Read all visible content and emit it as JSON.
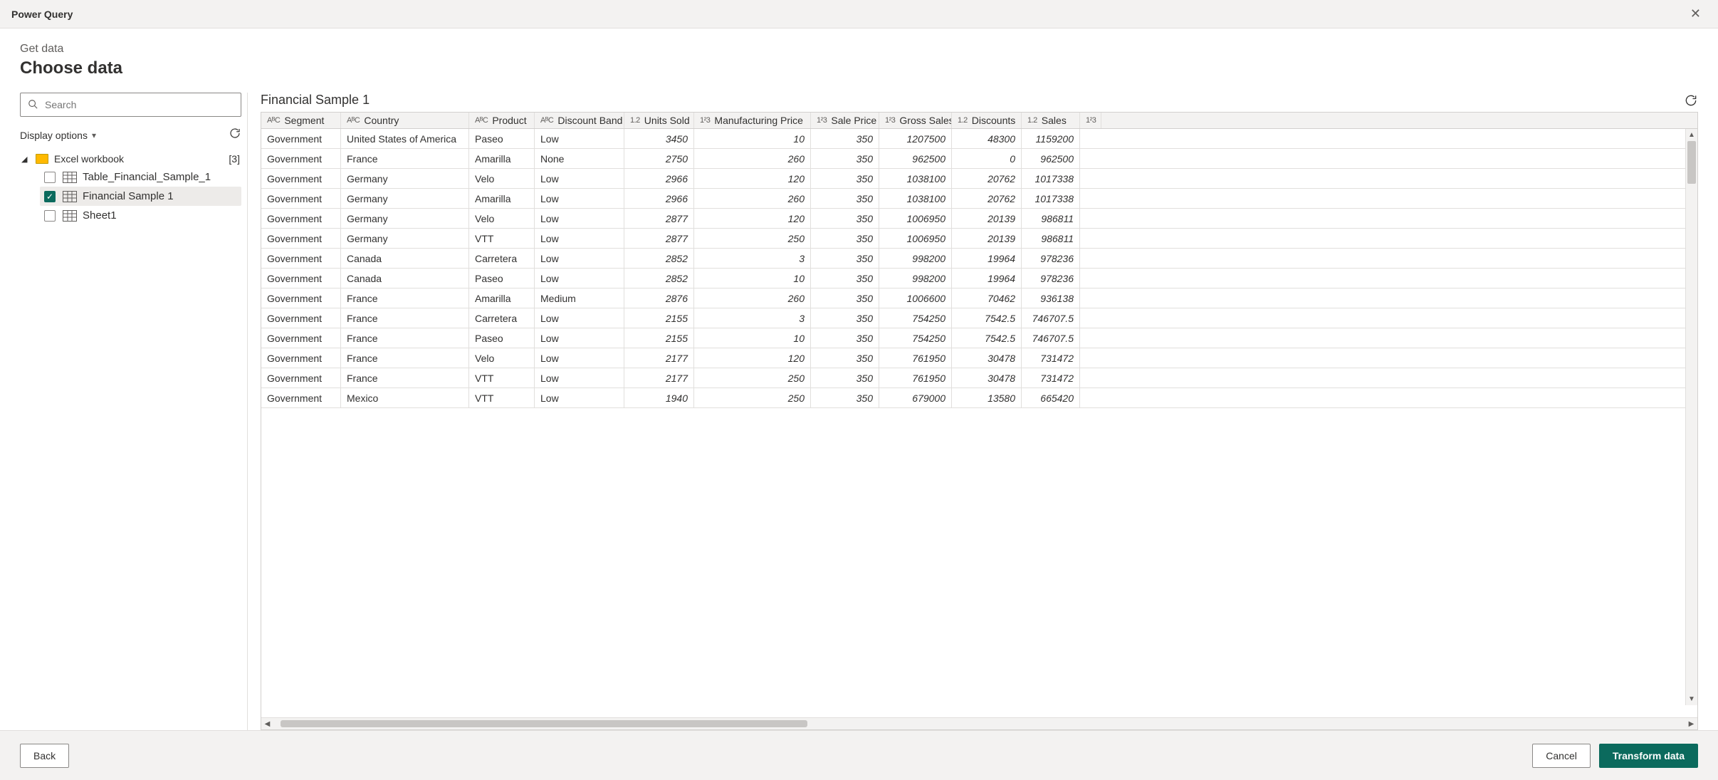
{
  "window": {
    "title": "Power Query"
  },
  "header": {
    "breadcrumb": "Get data",
    "title": "Choose data"
  },
  "left": {
    "search_placeholder": "Search",
    "display_options": "Display options",
    "root": {
      "label": "Excel workbook",
      "count": "[3]"
    },
    "items": [
      {
        "label": "Table_Financial_Sample_1",
        "checked": false,
        "selected": false
      },
      {
        "label": "Financial Sample 1",
        "checked": true,
        "selected": true
      },
      {
        "label": "Sheet1",
        "checked": false,
        "selected": false
      }
    ]
  },
  "preview": {
    "title": "Financial Sample 1",
    "columns": [
      {
        "type": "text",
        "label": "Segment"
      },
      {
        "type": "text",
        "label": "Country"
      },
      {
        "type": "text",
        "label": "Product"
      },
      {
        "type": "text",
        "label": "Discount Band"
      },
      {
        "type": "dec",
        "label": "Units Sold"
      },
      {
        "type": "int",
        "label": "Manufacturing Price"
      },
      {
        "type": "int",
        "label": "Sale Price"
      },
      {
        "type": "int",
        "label": "Gross Sales"
      },
      {
        "type": "dec",
        "label": "Discounts"
      },
      {
        "type": "dec",
        "label": "Sales"
      },
      {
        "type": "int",
        "label": ""
      }
    ],
    "rows": [
      [
        "Government",
        "United States of America",
        "Paseo",
        "Low",
        "3450",
        "10",
        "350",
        "1207500",
        "48300",
        "1159200"
      ],
      [
        "Government",
        "France",
        "Amarilla",
        "None",
        "2750",
        "260",
        "350",
        "962500",
        "0",
        "962500"
      ],
      [
        "Government",
        "Germany",
        "Velo",
        "Low",
        "2966",
        "120",
        "350",
        "1038100",
        "20762",
        "1017338"
      ],
      [
        "Government",
        "Germany",
        "Amarilla",
        "Low",
        "2966",
        "260",
        "350",
        "1038100",
        "20762",
        "1017338"
      ],
      [
        "Government",
        "Germany",
        "Velo",
        "Low",
        "2877",
        "120",
        "350",
        "1006950",
        "20139",
        "986811"
      ],
      [
        "Government",
        "Germany",
        "VTT",
        "Low",
        "2877",
        "250",
        "350",
        "1006950",
        "20139",
        "986811"
      ],
      [
        "Government",
        "Canada",
        "Carretera",
        "Low",
        "2852",
        "3",
        "350",
        "998200",
        "19964",
        "978236"
      ],
      [
        "Government",
        "Canada",
        "Paseo",
        "Low",
        "2852",
        "10",
        "350",
        "998200",
        "19964",
        "978236"
      ],
      [
        "Government",
        "France",
        "Amarilla",
        "Medium",
        "2876",
        "260",
        "350",
        "1006600",
        "70462",
        "936138"
      ],
      [
        "Government",
        "France",
        "Carretera",
        "Low",
        "2155",
        "3",
        "350",
        "754250",
        "7542.5",
        "746707.5"
      ],
      [
        "Government",
        "France",
        "Paseo",
        "Low",
        "2155",
        "10",
        "350",
        "754250",
        "7542.5",
        "746707.5"
      ],
      [
        "Government",
        "France",
        "Velo",
        "Low",
        "2177",
        "120",
        "350",
        "761950",
        "30478",
        "731472"
      ],
      [
        "Government",
        "France",
        "VTT",
        "Low",
        "2177",
        "250",
        "350",
        "761950",
        "30478",
        "731472"
      ],
      [
        "Government",
        "Mexico",
        "VTT",
        "Low",
        "1940",
        "250",
        "350",
        "679000",
        "13580",
        "665420"
      ]
    ]
  },
  "footer": {
    "back": "Back",
    "cancel": "Cancel",
    "transform": "Transform data"
  },
  "type_icons": {
    "text": "AᴮC",
    "dec": "1.2",
    "int": "1²3"
  }
}
